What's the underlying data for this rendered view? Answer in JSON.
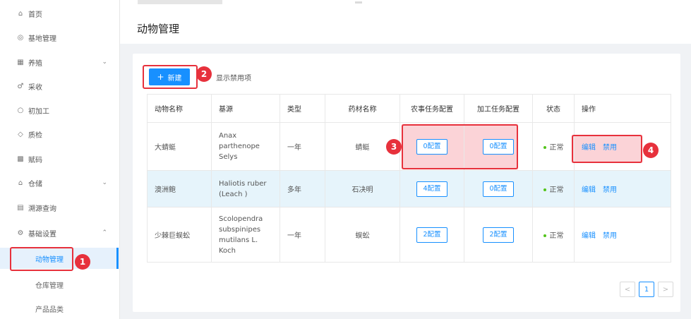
{
  "sidebar": {
    "items": [
      {
        "label": "首页",
        "icon": "home-icon"
      },
      {
        "label": "基地管理",
        "icon": "location-icon"
      },
      {
        "label": "养殖",
        "icon": "grid-icon"
      },
      {
        "label": "采收",
        "icon": "harvest-icon"
      },
      {
        "label": "初加工",
        "icon": "circle-icon"
      },
      {
        "label": "质检",
        "icon": "shield-icon"
      },
      {
        "label": "赋码",
        "icon": "qrcode-icon"
      },
      {
        "label": "仓储",
        "icon": "warehouse-icon"
      },
      {
        "label": "溯源查询",
        "icon": "search-doc-icon"
      },
      {
        "label": "基础设置",
        "icon": "settings-icon"
      }
    ],
    "subitems": [
      {
        "label": "动物管理"
      },
      {
        "label": "仓库管理"
      },
      {
        "label": "产品品类"
      }
    ]
  },
  "page": {
    "title": "动物管理"
  },
  "toolbar": {
    "new_label": "新建",
    "show_disabled_label": "显示禁用项"
  },
  "table": {
    "headers": [
      "动物名称",
      "基源",
      "类型",
      "药材名称",
      "农事任务配置",
      "加工任务配置",
      "状态",
      "操作"
    ],
    "rows": [
      {
        "name": "大蜻蜓",
        "source": [
          "Anax",
          "parthenope",
          "Selys"
        ],
        "type": "一年",
        "herb": "蜻蜓",
        "farm_cfg": "0配置",
        "proc_cfg": "0配置",
        "status": "正常",
        "edit": "编辑",
        "disable": "禁用"
      },
      {
        "name": "澳洲鲍",
        "source": [
          "Haliotis ruber",
          "(Leach )"
        ],
        "type": "多年",
        "herb": "石决明",
        "farm_cfg": "4配置",
        "proc_cfg": "0配置",
        "status": "正常",
        "edit": "编辑",
        "disable": "禁用"
      },
      {
        "name": "少棘巨蜈蚣",
        "source": [
          "Scolopendra",
          "subspinipes",
          "mutilans L.",
          "Koch"
        ],
        "type": "一年",
        "herb": "蜈蚣",
        "farm_cfg": "2配置",
        "proc_cfg": "2配置",
        "status": "正常",
        "edit": "编辑",
        "disable": "禁用"
      }
    ]
  },
  "pagination": {
    "prev": "<",
    "current": "1",
    "next": ">"
  },
  "annotations": {
    "b1": "1",
    "b2": "2",
    "b3": "3",
    "b4": "4"
  },
  "colors": {
    "primary": "#1890ff",
    "highlight": "#e7313c",
    "status_ok": "#52c41a"
  }
}
